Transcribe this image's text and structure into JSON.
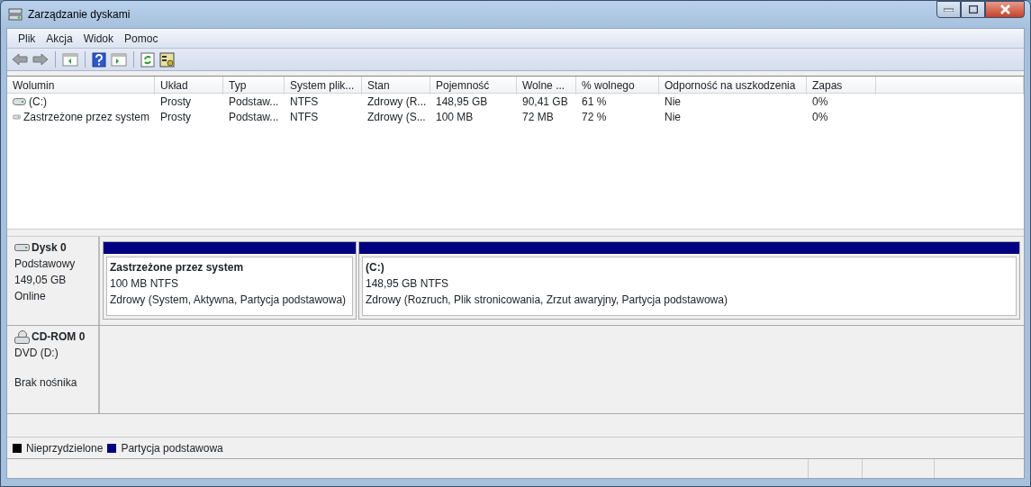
{
  "window": {
    "title": "Zarządzanie dyskami"
  },
  "menu": [
    "Plik",
    "Akcja",
    "Widok",
    "Pomoc"
  ],
  "table": {
    "columns": [
      "Wolumin",
      "Układ",
      "Typ",
      "System plik...",
      "Stan",
      "Pojemność",
      "Wolne ...",
      "% wolnego",
      "Odporność na uszkodzenia",
      "Zapas"
    ],
    "rows": [
      {
        "cells": [
          "(C:)",
          "Prosty",
          "Podstaw...",
          "NTFS",
          "Zdrowy (R...",
          "148,95 GB",
          "90,41 GB",
          "61 %",
          "Nie",
          "0%"
        ]
      },
      {
        "cells": [
          "Zastrzeżone przez system",
          "Prosty",
          "Podstaw...",
          "NTFS",
          "Zdrowy (S...",
          "100 MB",
          "72 MB",
          "72 %",
          "Nie",
          "0%"
        ]
      }
    ]
  },
  "disks": [
    {
      "kind": "disk",
      "name": "Dysk 0",
      "lines": [
        "Podstawowy",
        "149,05 GB",
        "Online"
      ],
      "partitions": [
        {
          "name": "Zastrzeżone przez system",
          "size": "100 MB NTFS",
          "status": "Zdrowy (System, Aktywna, Partycja podstawowa)",
          "color": "#000080"
        },
        {
          "name": "(C:)",
          "size": "148,95 GB NTFS",
          "status": "Zdrowy (Rozruch, Plik stronicowania, Zrzut awaryjny, Partycja podstawowa)",
          "color": "#000080"
        }
      ]
    },
    {
      "kind": "cdrom",
      "name": "CD-ROM 0",
      "lines": [
        "DVD (D:)",
        "Brak nośnika"
      ]
    }
  ],
  "legend": [
    {
      "label": "Nieprzydzielone",
      "color": "#000000"
    },
    {
      "label": "Partycja podstawowa",
      "color": "#000080"
    }
  ]
}
